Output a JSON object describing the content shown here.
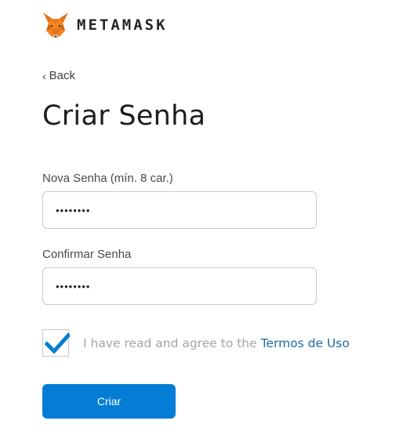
{
  "header": {
    "brand": "METAMASK",
    "logo_icon": "metamask-fox-icon"
  },
  "nav": {
    "back_label": "Back"
  },
  "page": {
    "title": "Criar Senha"
  },
  "form": {
    "new_password": {
      "label": "Nova Senha (mín. 8 car.)",
      "value": "••••••••"
    },
    "confirm_password": {
      "label": "Confirmar Senha",
      "value": "••••••••"
    },
    "terms": {
      "checked": true,
      "text": "I have read and agree to the ",
      "link_text": "Termos de Uso"
    },
    "submit_label": "Criar"
  },
  "colors": {
    "primary": "#037dd6",
    "link": "#1c6ba8",
    "check": "#037dd6",
    "fox_orange": "#e2761b"
  }
}
